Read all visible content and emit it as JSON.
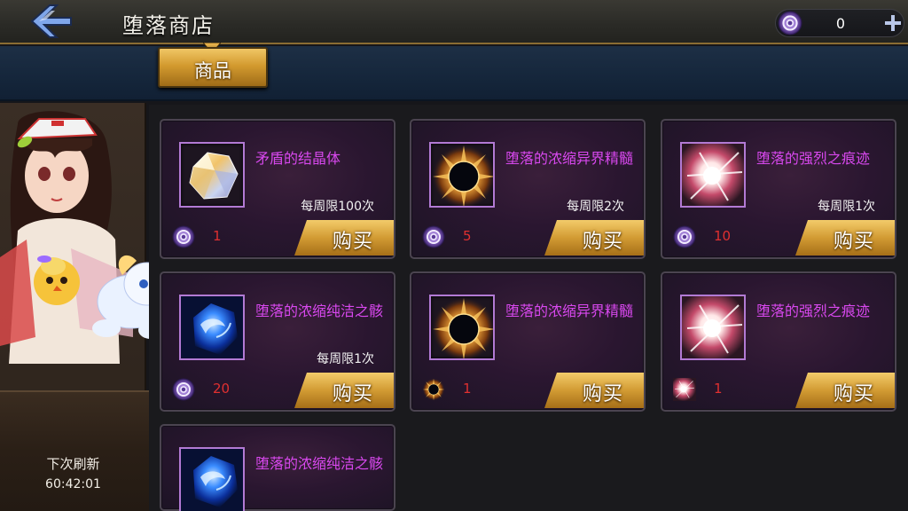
{
  "header": {
    "title": "堕落商店",
    "currency_value": "0"
  },
  "tabs": [
    {
      "label": "商品"
    }
  ],
  "sidebar": {
    "refresh_label": "下次刷新",
    "refresh_time": "60:42:01"
  },
  "colors": {
    "item_name": "#d848ee",
    "price": "#e03030",
    "buy_button": "#d29b33",
    "currency_ring": "#8a62c8"
  },
  "items": [
    {
      "name": "矛盾的结晶体",
      "icon": "crystal-icon",
      "limit": "每周限100次",
      "price": "1",
      "price_icon": "currency-icon",
      "buy_label": "购买"
    },
    {
      "name": "堕落的浓缩异界精髓",
      "icon": "dark-sun-icon",
      "limit": "每周限2次",
      "price": "5",
      "price_icon": "currency-icon",
      "buy_label": "购买"
    },
    {
      "name": "堕落的强烈之痕迹",
      "icon": "burst-icon",
      "limit": "每周限1次",
      "price": "10",
      "price_icon": "currency-icon",
      "buy_label": "购买"
    },
    {
      "name": "堕落的浓缩纯洁之骸",
      "icon": "blue-orb-icon",
      "limit": "每周限1次",
      "price": "20",
      "price_icon": "currency-icon",
      "buy_label": "购买"
    },
    {
      "name": "堕落的浓缩异界精髓",
      "icon": "dark-sun-icon",
      "limit": "",
      "price": "1",
      "price_icon": "dark-sun-icon",
      "buy_label": "购买"
    },
    {
      "name": "堕落的强烈之痕迹",
      "icon": "burst-icon",
      "limit": "",
      "price": "1",
      "price_icon": "burst-icon",
      "buy_label": "购买"
    },
    {
      "name": "堕落的浓缩纯洁之骸",
      "icon": "blue-orb-icon",
      "limit": "",
      "price": "",
      "price_icon": "",
      "buy_label": ""
    }
  ]
}
